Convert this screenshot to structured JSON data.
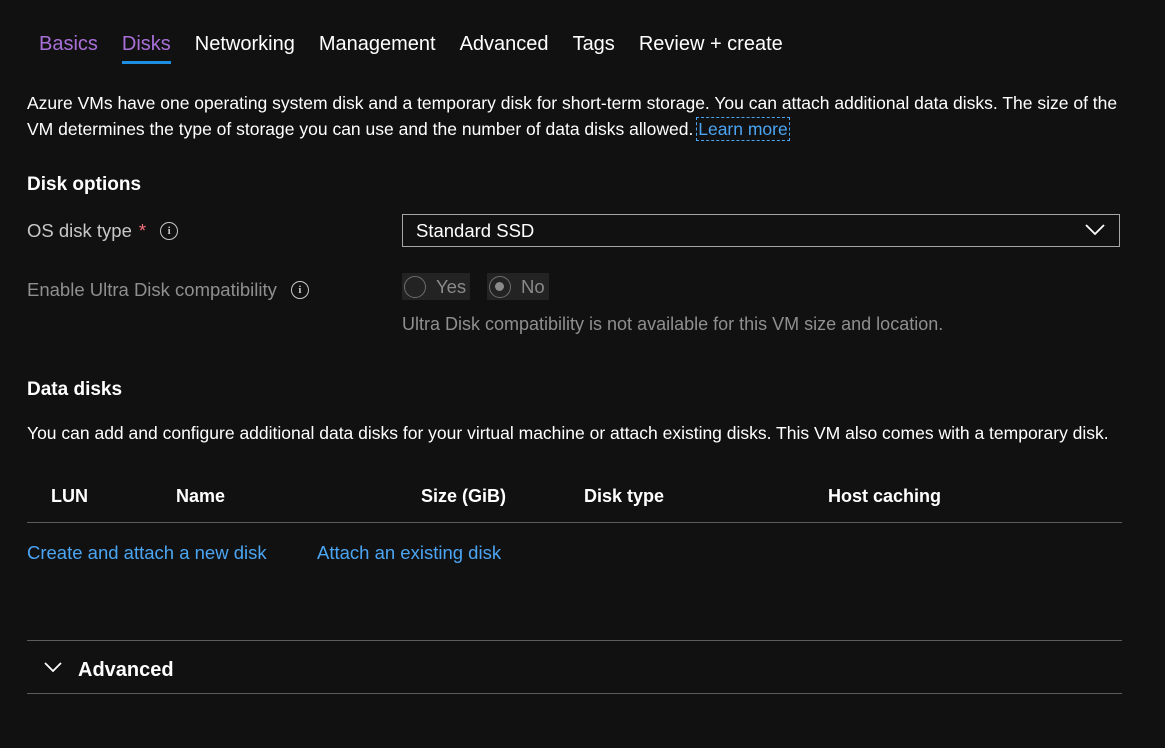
{
  "tabs": [
    {
      "label": "Basics"
    },
    {
      "label": "Disks"
    },
    {
      "label": "Networking"
    },
    {
      "label": "Management"
    },
    {
      "label": "Advanced"
    },
    {
      "label": "Tags"
    },
    {
      "label": "Review + create"
    }
  ],
  "intro": {
    "text": "Azure VMs have one operating system disk and a temporary disk for short-term storage. You can attach additional data disks. The size of the VM determines the type of storage you can use and the number of data disks allowed.",
    "learn_more": "Learn more"
  },
  "disk_options": {
    "heading": "Disk options",
    "os_disk_type": {
      "label": "OS disk type",
      "required": "*",
      "value": "Standard SSD"
    },
    "ultra_disk": {
      "label": "Enable Ultra Disk compatibility",
      "options": [
        "Yes",
        "No"
      ],
      "selected": "No",
      "hint": "Ultra Disk compatibility is not available for this VM size and location."
    }
  },
  "data_disks": {
    "heading": "Data disks",
    "description": "You can add and configure additional data disks for your virtual machine or attach existing disks. This VM also comes with a temporary disk.",
    "columns": [
      "LUN",
      "Name",
      "Size (GiB)",
      "Disk type",
      "Host caching"
    ],
    "create_link": "Create and attach a new disk",
    "attach_link": "Attach an existing disk"
  },
  "advanced": {
    "label": "Advanced"
  },
  "icons": {
    "info": "info-icon",
    "chevron": "chevron-down-icon"
  },
  "colors": {
    "accent": "#a870d8",
    "tab_underline": "#1e8fe0",
    "link": "#4ba5f2",
    "required": "#f1707b",
    "background": "#111112"
  }
}
